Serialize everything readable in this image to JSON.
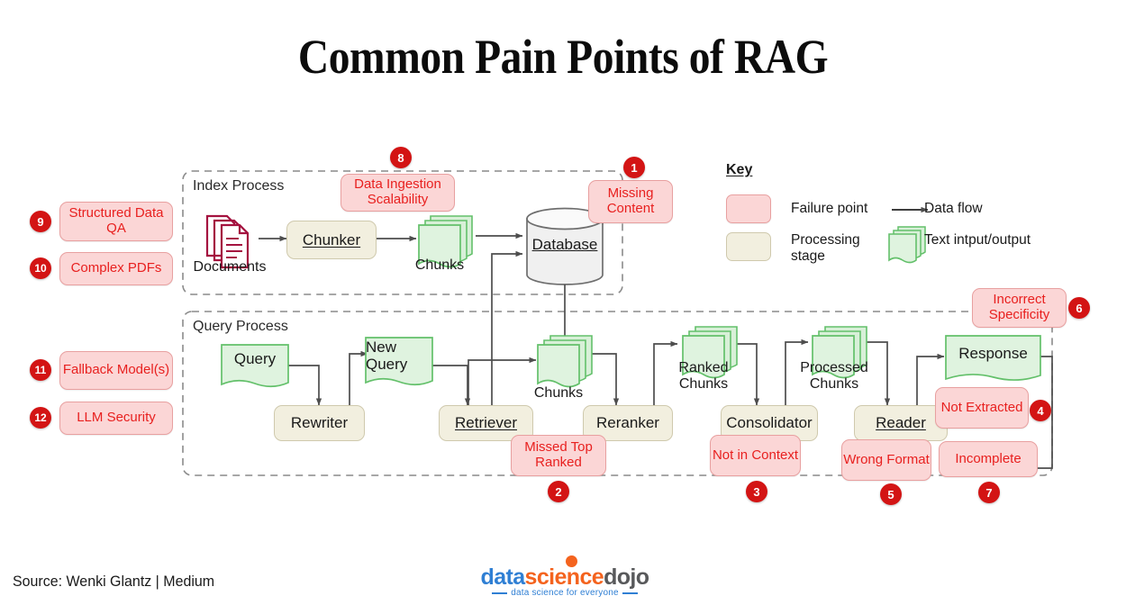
{
  "title": "Common Pain Points of RAG",
  "source": "Source: Wenki Glantz | Medium",
  "logo": {
    "part1": "data",
    "part2": "science",
    "part3": "dojo",
    "tagline": "data science for everyone",
    "blue": "#2f7fd4",
    "orange": "#f4631e",
    "gray": "#58595b"
  },
  "colors": {
    "failure_fill": "#fbd6d6",
    "failure_border": "#e8a0a0",
    "failure_text": "#e8201f",
    "stage_fill": "#f2efdf",
    "stage_border": "#cfc9ad",
    "chunk_fill": "#d8f0d8",
    "chunk_border": "#63c06a",
    "badge": "#d31414",
    "documents": "#a4123f",
    "arrow": "#4d4d4d",
    "dashed": "#8a8a8a"
  },
  "groups": {
    "index": "Index Process",
    "query": "Query Process"
  },
  "index_process": {
    "documents_label": "Documents",
    "chunker": "Chunker",
    "chunks": "Chunks",
    "database": "Database"
  },
  "query_process": {
    "query": "Query",
    "rewriter": "Rewriter",
    "new_query": "New Query",
    "retriever": "Retriever",
    "chunks": "Chunks",
    "reranker": "Reranker",
    "ranked_chunks": "Ranked Chunks",
    "consolidator": "Consolidator",
    "processed_chunks": "Processed Chunks",
    "reader": "Reader",
    "response": "Response"
  },
  "pain_points": [
    {
      "num": "1",
      "label": "Missing Content"
    },
    {
      "num": "2",
      "label": "Missed Top Ranked"
    },
    {
      "num": "3",
      "label": "Not in Context"
    },
    {
      "num": "4",
      "label": "Not Extracted"
    },
    {
      "num": "5",
      "label": "Wrong Format"
    },
    {
      "num": "6",
      "label": "Incorrect Specificity"
    },
    {
      "num": "7",
      "label": "Incomplete"
    },
    {
      "num": "8",
      "label": "Data Ingestion Scalability"
    },
    {
      "num": "9",
      "label": "Structured Data QA"
    },
    {
      "num": "10",
      "label": "Complex PDFs"
    },
    {
      "num": "11",
      "label": "Fallback Model(s)"
    },
    {
      "num": "12",
      "label": "LLM Security"
    }
  ],
  "key": {
    "title": "Key",
    "failure_point": "Failure point",
    "processing_stage": "Processing stage",
    "data_flow": "Data flow",
    "text_io": "Text intput/output"
  }
}
